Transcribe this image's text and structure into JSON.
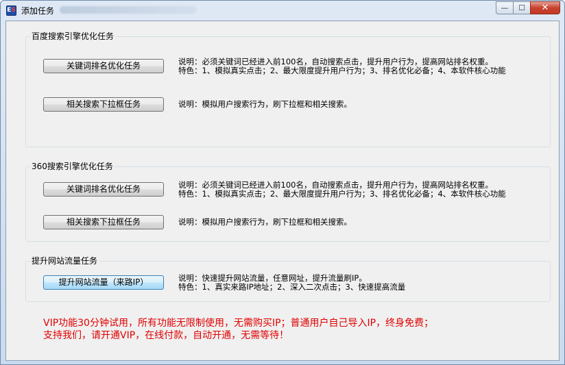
{
  "window": {
    "title": "添加任务",
    "app_icon_text_left": "E",
    "app_icon_text_right": "S",
    "min_glyph": "—",
    "max_glyph": "☐",
    "close_glyph": "✕"
  },
  "groups": [
    {
      "title": "百度搜索引擎优化任务",
      "tasks": [
        {
          "button": "关键词排名优化任务",
          "desc1": "说明：必须关键词已经进入前100名，自动搜索点击，提升用户行为，提高网站排名权重。",
          "desc2": "特色：1、模拟真实点击；2、最大限度提升用户行为；3、排名优化必备；4、本软件核心功能"
        },
        {
          "button": "相关搜索下拉框任务",
          "desc1": "说明：模拟用户搜索行为，刷下拉框和相关搜索。"
        }
      ]
    },
    {
      "title": "360搜索引擎优化任务",
      "tasks": [
        {
          "button": "关键词排名优化任务",
          "desc1": "说明：必须关键词已经进入前100名，自动搜索点击，提升用户行为，提高网站排名权重。",
          "desc2": "特色：1、模拟真实点击；2、最大限度提升用户行为；3、排名优化必备；4、本软件核心功能"
        },
        {
          "button": "相关搜索下拉框任务",
          "desc1": "说明：模拟用户搜索行为，刷下拉框和相关搜索。"
        }
      ]
    },
    {
      "title": "提升网站流量任务",
      "tasks": [
        {
          "button": "提升网站流量（来路IP）",
          "desc1": "说明：快速提升网站流量，任意网址，提升流量刷IP。",
          "desc2": "特色：1、真实来路IP地址；2、深入二次点击；3、快速提高流量"
        }
      ]
    }
  ],
  "promo": {
    "line1": "VIP功能30分钟试用，所有功能无限制使用，无需购买IP；普通用户自己导入IP，终身免费；",
    "line2": "支持我们，请开通VIP，在线付款，自动开通，无需等待！",
    "color": "#e00000"
  }
}
